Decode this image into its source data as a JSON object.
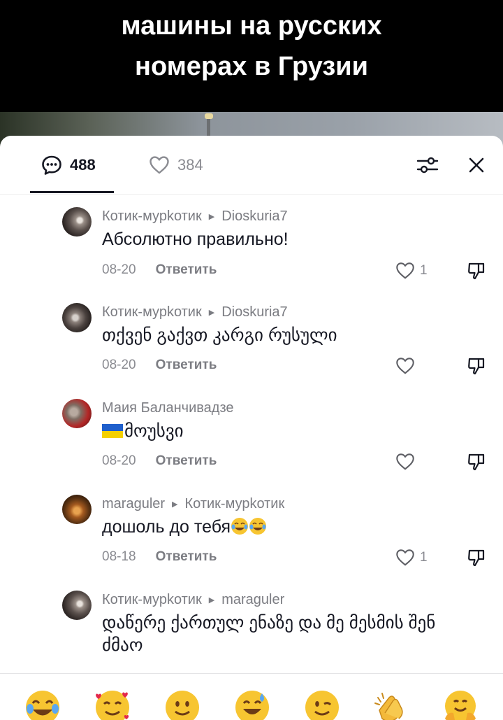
{
  "video": {
    "title_line1": "машины на русских",
    "title_line2": "номерах в Грузии"
  },
  "tabs": {
    "comments_count": "488",
    "likes_count": "384",
    "icons": {
      "comments": "chat-bubble-icon",
      "likes": "heart-outline-icon",
      "filter": "sliders-icon",
      "close": "close-icon"
    }
  },
  "comments": [
    {
      "author": "Котик-мурkотик",
      "reply_to": "Dioskuria7",
      "text": "Абсолютно правильно!",
      "date": "08-20",
      "reply_label": "Ответить",
      "likes": "1"
    },
    {
      "author": "Котик-мурkотик",
      "reply_to": "Dioskuria7",
      "text": "თქვენ გაქვთ კარგი რუსული",
      "date": "08-20",
      "reply_label": "Ответить",
      "likes": ""
    },
    {
      "author": "Маия Баланчивадзе",
      "reply_to": "",
      "text": "მოუსვი",
      "date": "08-20",
      "reply_label": "Ответить",
      "likes": ""
    },
    {
      "author": "maraguler",
      "reply_to": "Котик-мурkотик",
      "text": "дошоль до тебя",
      "date": "08-18",
      "reply_label": "Ответить",
      "likes": "1"
    },
    {
      "author": "Котик-мурkотик",
      "reply_to": "maraguler",
      "text": "დაწერე ქართულ ენაზე და მე მესმის შენ ძმაო",
      "date": "",
      "reply_label": "",
      "likes": ""
    }
  ],
  "emoji_bar": [
    "face-with-tears-of-joy",
    "smiling-face-with-hearts",
    "slightly-smiling-face",
    "grinning-face-with-sweat",
    "winking-face",
    "clapping-hands",
    "hugging-face"
  ]
}
